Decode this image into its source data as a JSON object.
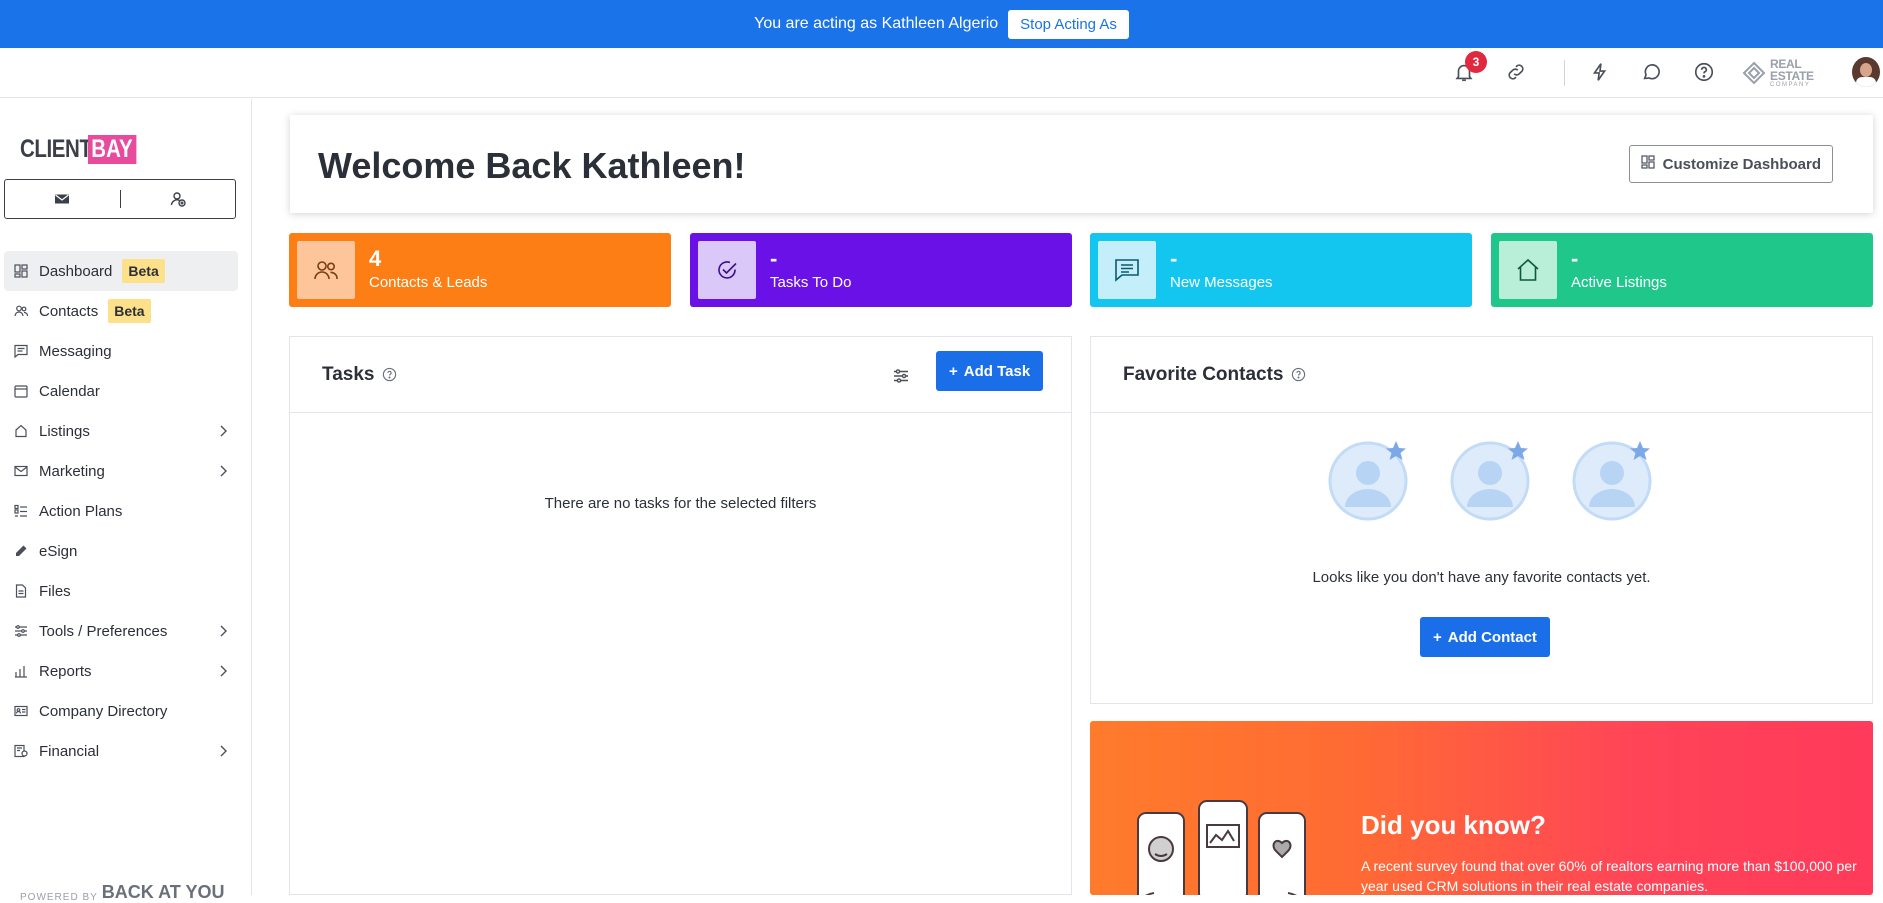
{
  "impersonation": {
    "message": "You are acting as Kathleen Algerio",
    "stop_label": "Stop Acting As"
  },
  "topbar": {
    "notification_count": "3",
    "company_logo_text": "REAL ESTATE",
    "company_logo_sub": "COMPANY",
    "icons": [
      "bell-icon",
      "link-icon",
      "lightning-icon",
      "chat-icon",
      "help-icon"
    ]
  },
  "sidebar": {
    "brand_left": "CLIENT",
    "brand_right": "BAY",
    "items": [
      {
        "label": "Dashboard",
        "badge": "Beta",
        "icon": "dashboard-icon",
        "active": true
      },
      {
        "label": "Contacts",
        "badge": "Beta",
        "icon": "contacts-icon"
      },
      {
        "label": "Messaging",
        "icon": "messaging-icon"
      },
      {
        "label": "Calendar",
        "icon": "calendar-icon"
      },
      {
        "label": "Listings",
        "icon": "listings-icon",
        "expandable": true
      },
      {
        "label": "Marketing",
        "icon": "marketing-icon",
        "expandable": true
      },
      {
        "label": "Action Plans",
        "icon": "action-plans-icon"
      },
      {
        "label": "eSign",
        "icon": "pen-icon"
      },
      {
        "label": "Files",
        "icon": "file-icon"
      },
      {
        "label": "Tools / Preferences",
        "icon": "sliders-icon",
        "expandable": true
      },
      {
        "label": "Reports",
        "icon": "bar-chart-icon",
        "expandable": true
      },
      {
        "label": "Company Directory",
        "icon": "id-card-icon"
      },
      {
        "label": "Financial",
        "icon": "financial-icon",
        "expandable": true
      }
    ],
    "powered_by": "POWERED BY",
    "powered_brand": "BACK AT YOU"
  },
  "welcome": {
    "title": "Welcome Back Kathleen!",
    "customize_label": "Customize Dashboard"
  },
  "stats": [
    {
      "value": "4",
      "label": "Contacts & Leads",
      "color": "#fd7e14",
      "icon_bg": "#fec49a"
    },
    {
      "value": "-",
      "label": "Tasks To Do",
      "color": "#6a11e8",
      "icon_bg": "#d9c8f8"
    },
    {
      "value": "-",
      "label": "New Messages",
      "color": "#13c6ef",
      "icon_bg": "#c5eefb"
    },
    {
      "value": "-",
      "label": "Active Listings",
      "color": "#1fc88a",
      "icon_bg": "#b9efd9"
    }
  ],
  "tasks": {
    "title": "Tasks",
    "add_label": "Add Task",
    "empty_message": "There are no tasks for the selected filters"
  },
  "favorites": {
    "title": "Favorite Contacts",
    "empty_message": "Looks like you don't have any favorite contacts yet.",
    "add_label": "Add Contact"
  },
  "promo": {
    "title": "Did you know?",
    "text": "A recent survey found that over 60% of realtors earning more than $100,000 per year used CRM solutions in their real estate companies."
  }
}
